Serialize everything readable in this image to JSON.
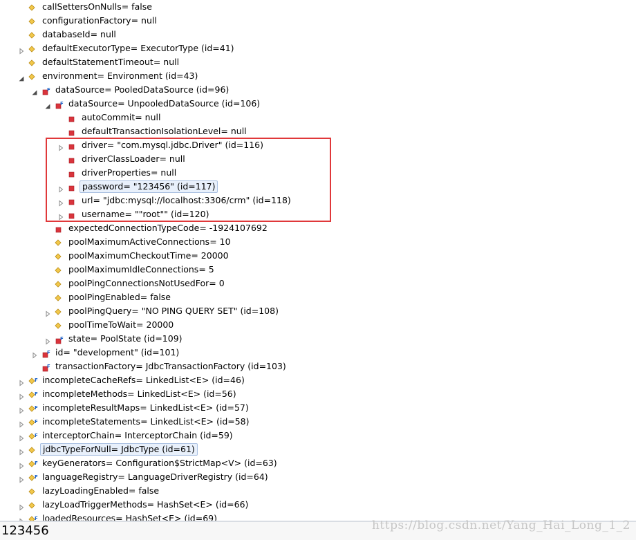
{
  "tree_rows": [
    {
      "label": "callSettersOnNulls= false",
      "depth": 0,
      "expander": "none",
      "icon": "field-private"
    },
    {
      "label": "configurationFactory= null",
      "depth": 0,
      "expander": "none",
      "icon": "field-private"
    },
    {
      "label": "databaseId= null",
      "depth": 0,
      "expander": "none",
      "icon": "field-private"
    },
    {
      "label": "defaultExecutorType= ExecutorType  (id=41)",
      "depth": 0,
      "expander": "collapsed",
      "icon": "field-private"
    },
    {
      "label": "defaultStatementTimeout= null",
      "depth": 0,
      "expander": "none",
      "icon": "field-private"
    },
    {
      "label": "environment= Environment  (id=43)",
      "depth": 0,
      "expander": "expanded",
      "icon": "field-private"
    },
    {
      "label": "dataSource= PooledDataSource  (id=96)",
      "depth": 1,
      "expander": "expanded",
      "icon": "field-final-private"
    },
    {
      "label": "dataSource= UnpooledDataSource  (id=106)",
      "depth": 2,
      "expander": "expanded",
      "icon": "field-final-private"
    },
    {
      "label": "autoCommit= null",
      "depth": 3,
      "expander": "none",
      "icon": "field-red"
    },
    {
      "label": "defaultTransactionIsolationLevel= null",
      "depth": 3,
      "expander": "none",
      "icon": "field-red"
    },
    {
      "label": "driver= \"com.mysql.jdbc.Driver\" (id=116)",
      "depth": 3,
      "expander": "collapsed",
      "icon": "field-red"
    },
    {
      "label": "driverClassLoader= null",
      "depth": 3,
      "expander": "none",
      "icon": "field-red"
    },
    {
      "label": "driverProperties= null",
      "depth": 3,
      "expander": "none",
      "icon": "field-red"
    },
    {
      "label": "password= \"123456\" (id=117)",
      "depth": 3,
      "expander": "collapsed",
      "icon": "field-red",
      "selected": true
    },
    {
      "label": "url= \"jdbc:mysql://localhost:3306/crm\" (id=118)",
      "depth": 3,
      "expander": "collapsed",
      "icon": "field-red"
    },
    {
      "label": "username= \"\"root\"\" (id=120)",
      "depth": 3,
      "expander": "collapsed",
      "icon": "field-red"
    },
    {
      "label": "expectedConnectionTypeCode= -1924107692",
      "depth": 2,
      "expander": "none",
      "icon": "field-red"
    },
    {
      "label": "poolMaximumActiveConnections= 10",
      "depth": 2,
      "expander": "none",
      "icon": "field-private"
    },
    {
      "label": "poolMaximumCheckoutTime= 20000",
      "depth": 2,
      "expander": "none",
      "icon": "field-private"
    },
    {
      "label": "poolMaximumIdleConnections= 5",
      "depth": 2,
      "expander": "none",
      "icon": "field-private"
    },
    {
      "label": "poolPingConnectionsNotUsedFor= 0",
      "depth": 2,
      "expander": "none",
      "icon": "field-private"
    },
    {
      "label": "poolPingEnabled= false",
      "depth": 2,
      "expander": "none",
      "icon": "field-private"
    },
    {
      "label": "poolPingQuery= \"NO PING QUERY SET\" (id=108)",
      "depth": 2,
      "expander": "collapsed",
      "icon": "field-private"
    },
    {
      "label": "poolTimeToWait= 20000",
      "depth": 2,
      "expander": "none",
      "icon": "field-private"
    },
    {
      "label": "state= PoolState  (id=109)",
      "depth": 2,
      "expander": "collapsed",
      "icon": "field-final-private"
    },
    {
      "label": "id= \"development\" (id=101)",
      "depth": 1,
      "expander": "collapsed",
      "icon": "field-final-private"
    },
    {
      "label": "transactionFactory= JdbcTransactionFactory  (id=103)",
      "depth": 1,
      "expander": "none",
      "icon": "field-final-private"
    },
    {
      "label": "incompleteCacheRefs= LinkedList<E>  (id=46)",
      "depth": 0,
      "expander": "collapsed",
      "icon": "field-final-protected"
    },
    {
      "label": "incompleteMethods= LinkedList<E>  (id=56)",
      "depth": 0,
      "expander": "collapsed",
      "icon": "field-final-protected"
    },
    {
      "label": "incompleteResultMaps= LinkedList<E>  (id=57)",
      "depth": 0,
      "expander": "collapsed",
      "icon": "field-final-protected"
    },
    {
      "label": "incompleteStatements= LinkedList<E>  (id=58)",
      "depth": 0,
      "expander": "collapsed",
      "icon": "field-final-protected"
    },
    {
      "label": "interceptorChain= InterceptorChain  (id=59)",
      "depth": 0,
      "expander": "collapsed",
      "icon": "field-final-protected"
    },
    {
      "label": "jdbcTypeForNull= JdbcType  (id=61)",
      "depth": 0,
      "expander": "collapsed",
      "icon": "field-private",
      "selected_soft": true
    },
    {
      "label": "keyGenerators= Configuration$StrictMap<V>  (id=63)",
      "depth": 0,
      "expander": "collapsed",
      "icon": "field-final-protected"
    },
    {
      "label": "languageRegistry= LanguageDriverRegistry  (id=64)",
      "depth": 0,
      "expander": "collapsed",
      "icon": "field-final-protected"
    },
    {
      "label": "lazyLoadingEnabled= false",
      "depth": 0,
      "expander": "none",
      "icon": "field-private"
    },
    {
      "label": "lazyLoadTriggerMethods= HashSet<E>  (id=66)",
      "depth": 0,
      "expander": "collapsed",
      "icon": "field-private"
    },
    {
      "label": "loadedResources= HashSet<E>  (id=69)",
      "depth": 0,
      "expander": "collapsed",
      "icon": "field-final-protected"
    }
  ],
  "detail_pane": {
    "value": "123456"
  },
  "watermark": "https://blog.csdn.net/Yang_Hai_Long_1_2",
  "colors": {
    "highlight_box": "#e0383a",
    "selection_bg": "#e8f0fb",
    "private_field": "#e8b73a",
    "red_field": "#d9343c"
  }
}
